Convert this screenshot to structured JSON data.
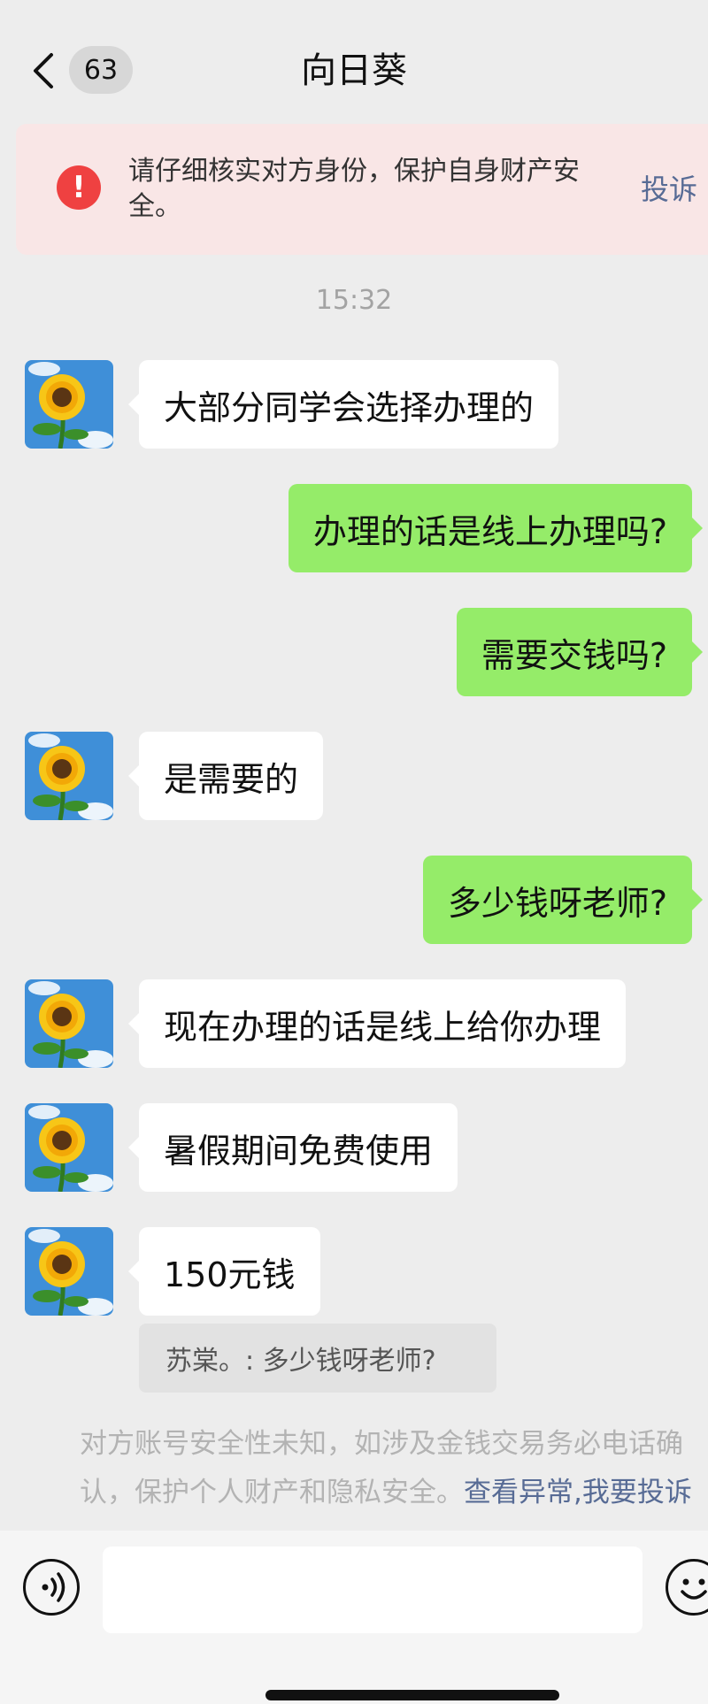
{
  "header": {
    "unread_count": "63",
    "title": "向日葵"
  },
  "warning": {
    "text": "请仔细核实对方身份，保护自身财产安全。",
    "action": "投诉"
  },
  "timestamp": "15:32",
  "messages": [
    {
      "side": "left",
      "text": "大部分同学会选择办理的"
    },
    {
      "side": "right",
      "text": "办理的话是线上办理吗?"
    },
    {
      "side": "right",
      "text": "需要交钱吗?"
    },
    {
      "side": "left",
      "text": "是需要的"
    },
    {
      "side": "right",
      "text": "多少钱呀老师?"
    },
    {
      "side": "left",
      "text": "现在办理的话是线上给你办理"
    },
    {
      "side": "left",
      "text": "暑假期间免费使用"
    },
    {
      "side": "left",
      "text": "150元钱"
    }
  ],
  "quote": {
    "text": "苏棠。: 多少钱呀老师?"
  },
  "notice": {
    "text": "对方账号安全性未知，如涉及金钱交易务必电话确认，保护个人财产和隐私安全。",
    "link1": "查看异常",
    "sep": ",",
    "link2": "我要投诉"
  },
  "colors": {
    "background": "#ededed",
    "sent_bubble": "#95ec69",
    "received_bubble": "#ffffff",
    "warning_bg": "#f9e6e6",
    "warning_icon": "#ef4141",
    "link": "#576b95"
  },
  "icons": {
    "back": "chevron-left-icon",
    "warning": "exclamation-circle-icon",
    "voice": "voice-icon",
    "emoji": "emoji-icon"
  }
}
